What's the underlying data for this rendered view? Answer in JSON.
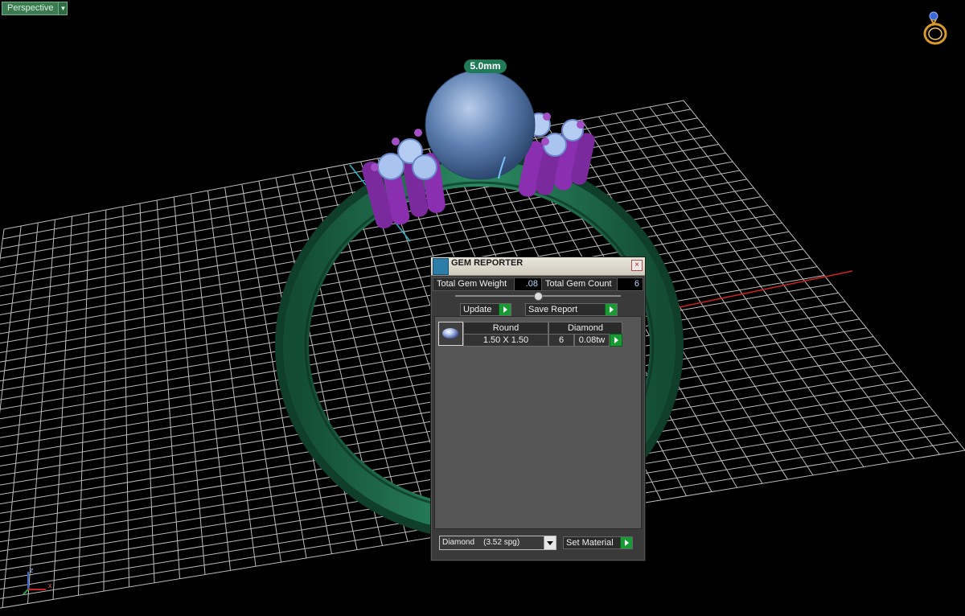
{
  "viewport": {
    "view_label": "Perspective",
    "dimension_label": "5.0mm",
    "axes": {
      "z": "z",
      "x": "x"
    }
  },
  "gem_reporter": {
    "title": "GEM REPORTER",
    "close_glyph": "×",
    "total_gem_weight_label": "Total Gem Weight",
    "total_gem_weight_value": ".08",
    "total_gem_count_label": "Total Gem Count",
    "total_gem_count_value": "6",
    "update_label": "Update",
    "save_report_label": "Save Report",
    "table": {
      "headers": [
        "Round",
        "Diamond"
      ],
      "rows": [
        {
          "size": "1.50 X 1.50",
          "count": "6",
          "weight": "0.08tw"
        }
      ]
    },
    "material_select_value": "Diamond    (3.52 spg)",
    "set_material_label": "Set Material"
  },
  "colors": {
    "ring_metal": "#1f6b4c",
    "prongs": "#8a2fb0",
    "center_stone": "#5d7fb0",
    "grid": "#ffffff",
    "accent_green": "#1a9a35"
  }
}
